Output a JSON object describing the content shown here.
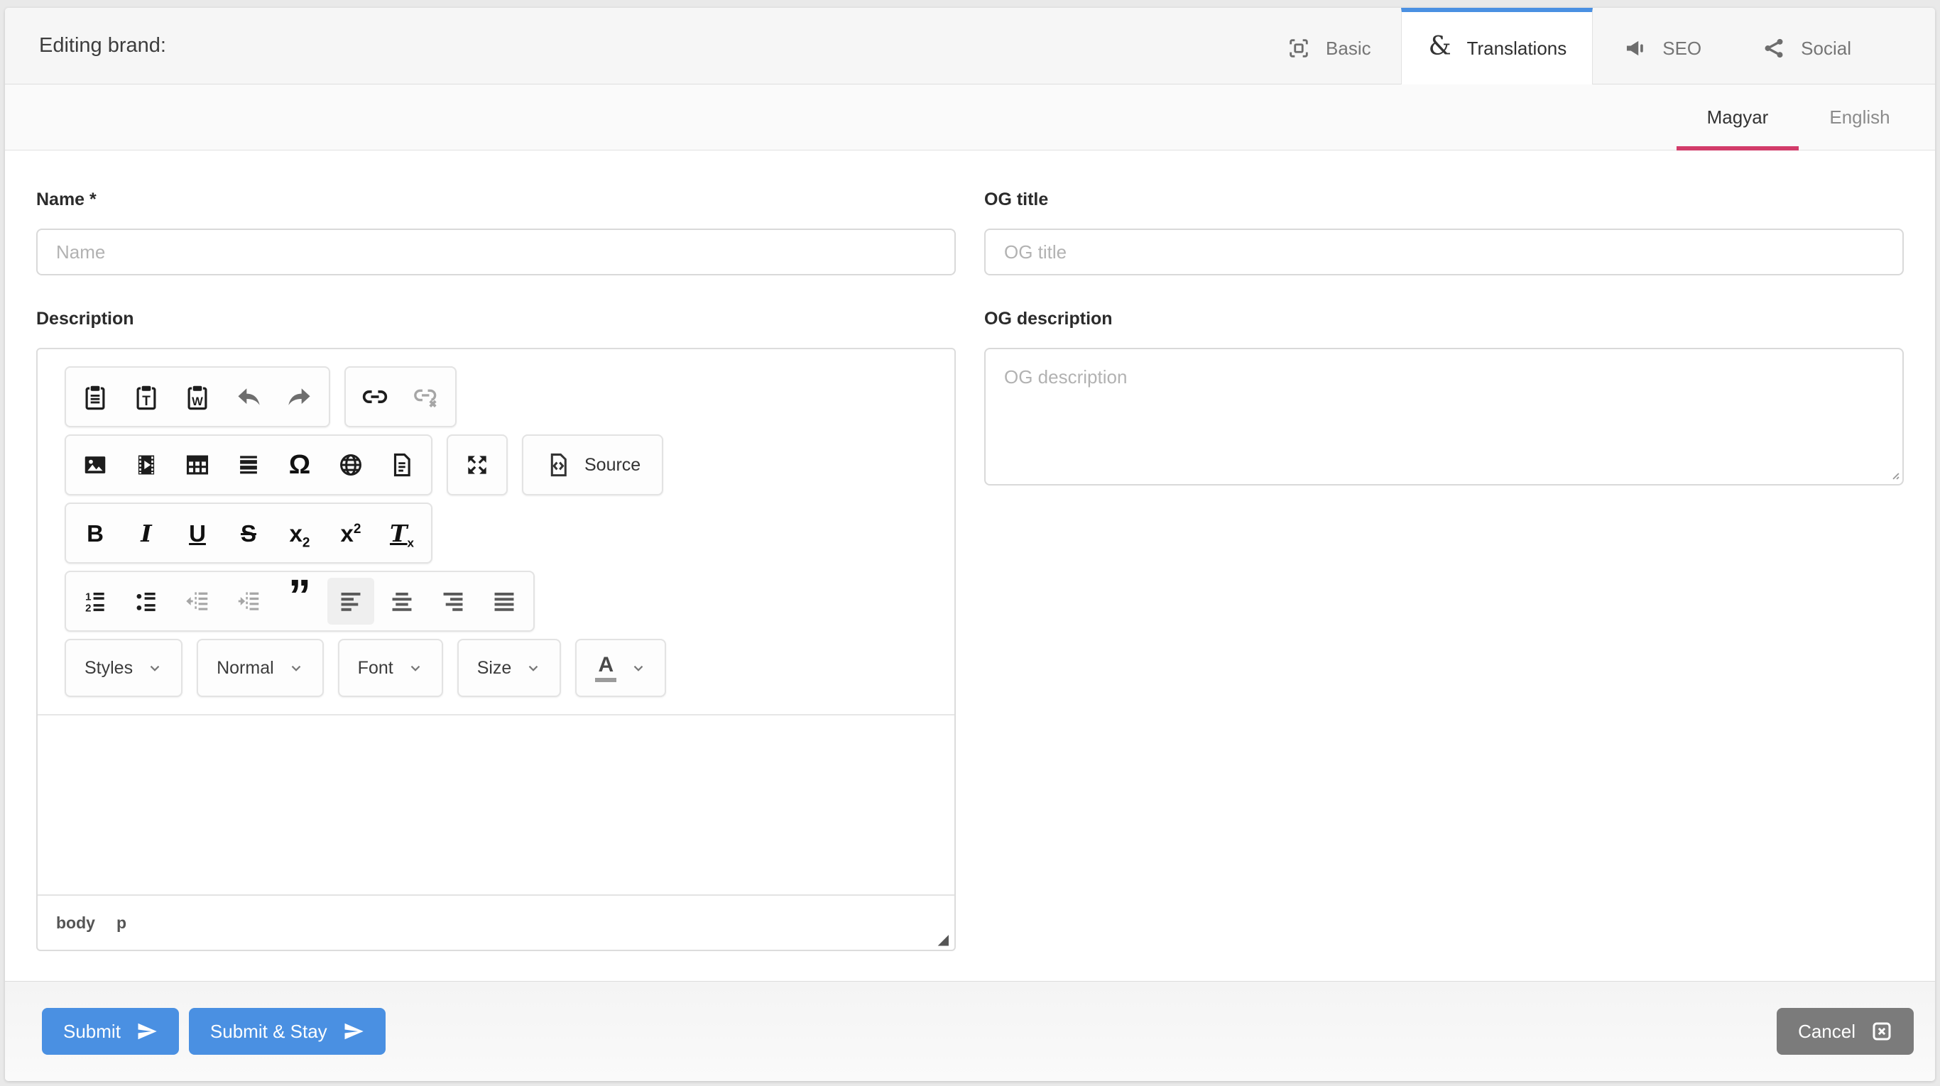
{
  "header": {
    "title": "Editing brand:",
    "tabs": [
      {
        "label": "Basic",
        "active": false
      },
      {
        "label": "Translations",
        "active": true
      },
      {
        "label": "SEO",
        "active": false
      },
      {
        "label": "Social",
        "active": false
      }
    ],
    "ampersand_glyph": "&"
  },
  "language_bar": {
    "tabs": [
      {
        "label": "Magyar",
        "active": true
      },
      {
        "label": "English",
        "active": false
      }
    ]
  },
  "form": {
    "name": {
      "label": "Name *",
      "placeholder": "Name",
      "value": ""
    },
    "description": {
      "label": "Description"
    },
    "og_title": {
      "label": "OG title",
      "placeholder": "OG title",
      "value": ""
    },
    "og_description": {
      "label": "OG description",
      "placeholder": "OG description",
      "value": ""
    }
  },
  "editor": {
    "toolbar": {
      "source_label": "Source",
      "styles_label": "Styles",
      "format_label": "Normal",
      "font_label": "Font",
      "size_label": "Size",
      "glyphs": {
        "bold": "B",
        "italic": "I",
        "underline": "U",
        "strike": "S",
        "sub_base": "x",
        "sub_mark": "2",
        "sup_base": "x",
        "sup_mark": "2",
        "removeformat_base": "T",
        "removeformat_mark": "x",
        "omega": "Ω",
        "quote": "”",
        "ol_first": "1",
        "ol_second": "2",
        "fontcolor": "A"
      }
    },
    "element_path": [
      "body",
      "p"
    ],
    "resize_glyph": "◢"
  },
  "footer": {
    "submit_label": "Submit",
    "submit_stay_label": "Submit & Stay",
    "cancel_label": "Cancel"
  },
  "colors": {
    "accent_blue": "#4a90e2",
    "active_language_underline": "#d23c6a",
    "cancel_gray": "#7b7b7b",
    "header_bg": "#f6f6f6"
  }
}
